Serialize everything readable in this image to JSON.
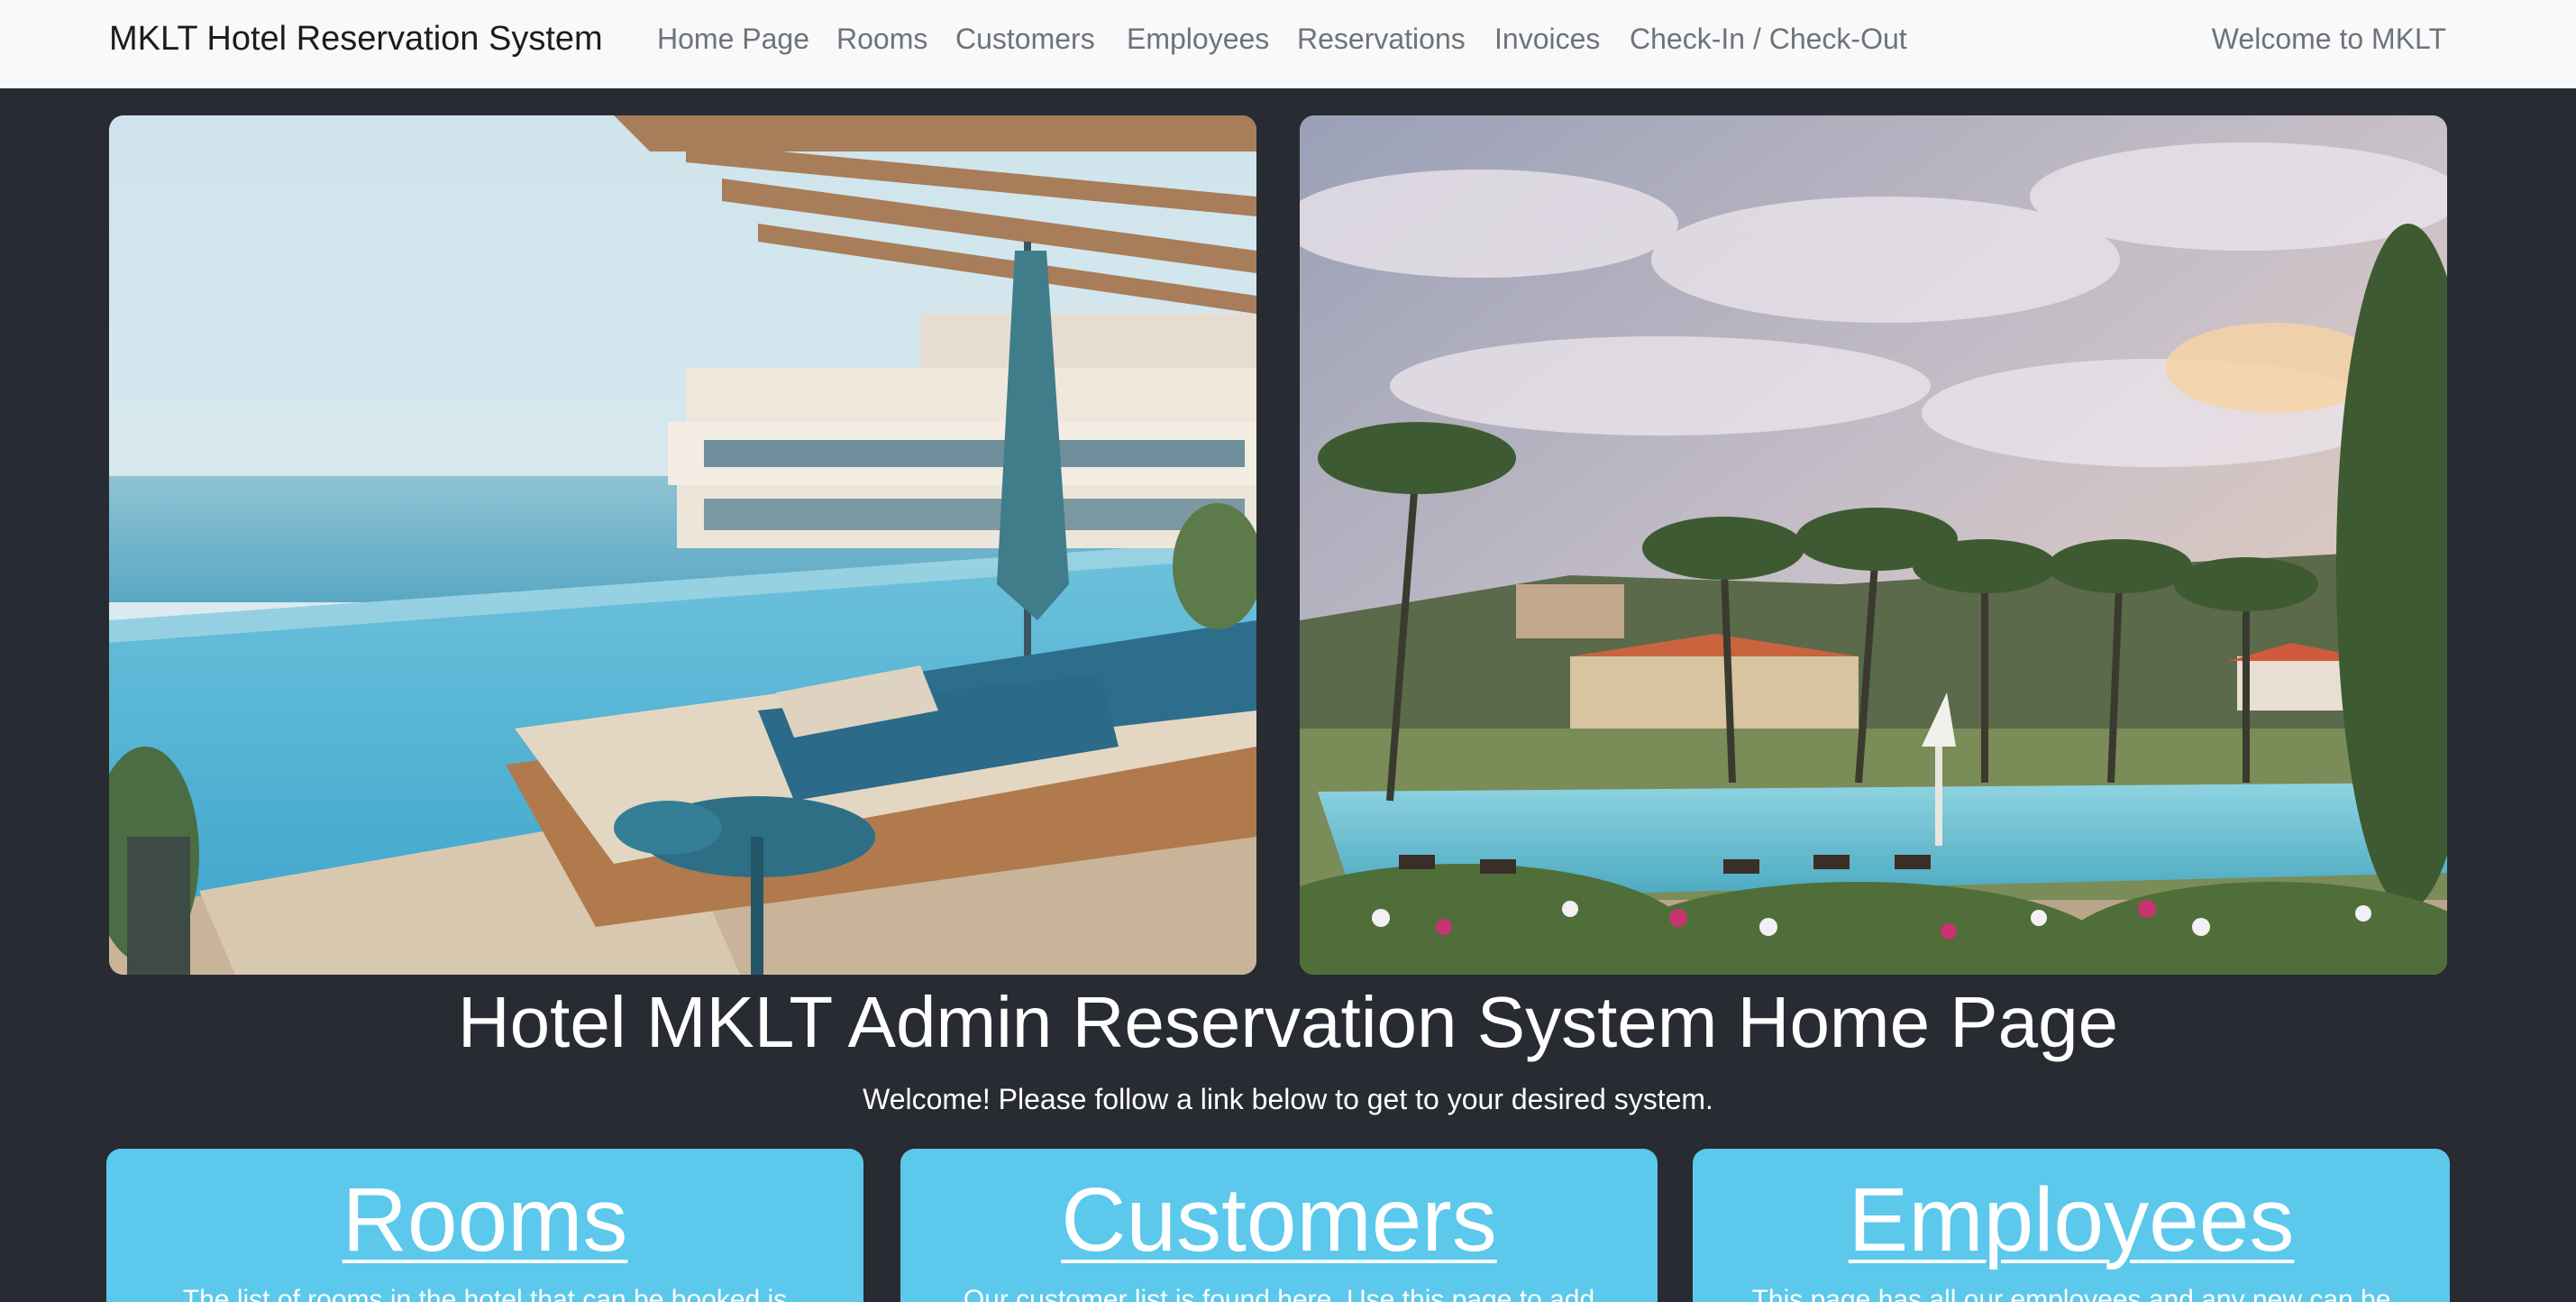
{
  "navbar": {
    "brand": "MKLT Hotel Reservation System",
    "links": [
      "Home Page",
      "Rooms",
      "Customers",
      "Employees",
      "Reservations",
      "Invoices",
      "Check-In / Check-Out"
    ],
    "welcome": "Welcome to MKLT"
  },
  "hero": {
    "title": "Hotel MKLT Admin Reservation System Home Page",
    "subtitle": "Welcome! Please follow a link below to get to your desired system."
  },
  "cards": [
    {
      "title": "Rooms",
      "text": "The list of rooms in the hotel that can be booked is"
    },
    {
      "title": "Customers",
      "text": "Our customer list is found here. Use this page to add"
    },
    {
      "title": "Employees",
      "text": "This page has all our employees and any new can be"
    }
  ],
  "colors": {
    "background": "#282b31",
    "navbar": "#f8f9fa",
    "card": "#5bc8ec"
  }
}
